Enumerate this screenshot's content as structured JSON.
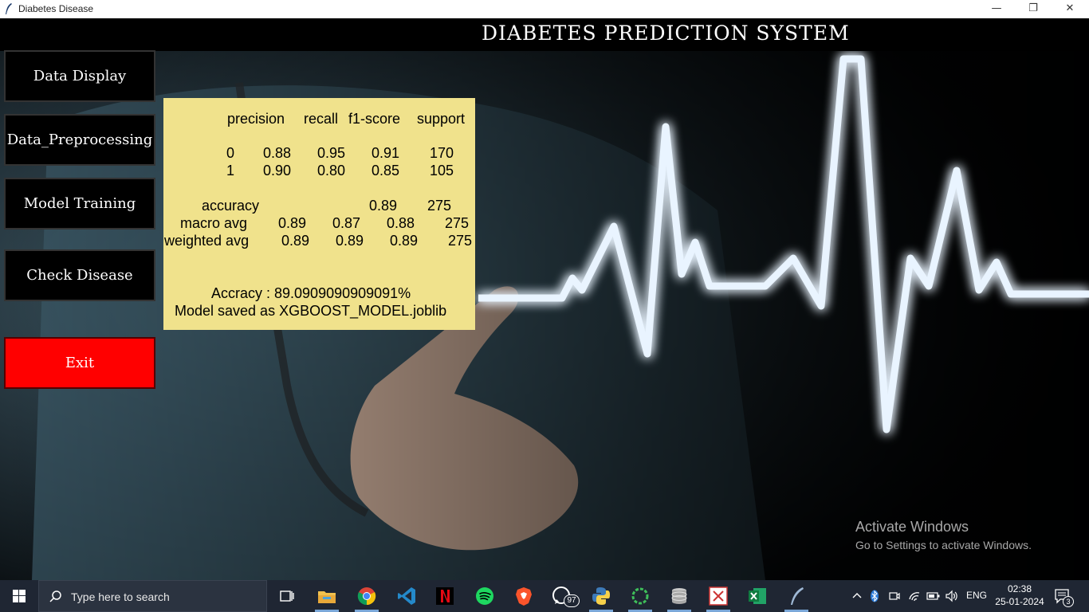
{
  "window": {
    "title": "Diabetes Disease",
    "minimize": "—",
    "maximize": "❐",
    "close": "✕"
  },
  "app": {
    "title": "DIABETES PREDICTION SYSTEM"
  },
  "sidebar": {
    "items": [
      {
        "label": "Data Display"
      },
      {
        "label": "Data_Preprocessing"
      },
      {
        "label": "Model Training"
      },
      {
        "label": "Check Disease"
      },
      {
        "label": "Exit"
      }
    ]
  },
  "report": {
    "headers": [
      "precision",
      "recall",
      "f1-score",
      "support"
    ],
    "rows": [
      {
        "label": "0",
        "precision": "0.88",
        "recall": "0.95",
        "f1": "0.91",
        "support": "170"
      },
      {
        "label": "1",
        "precision": "0.90",
        "recall": "0.80",
        "f1": "0.85",
        "support": "105"
      }
    ],
    "accuracy": {
      "label": "accuracy",
      "f1": "0.89",
      "support": "275"
    },
    "macro": {
      "label": "macro avg",
      "precision": "0.89",
      "recall": "0.87",
      "f1": "0.88",
      "support": "275"
    },
    "weighted": {
      "label": "weighted avg",
      "precision": "0.89",
      "recall": "0.89",
      "f1": "0.89",
      "support": "275"
    },
    "accuracy_line": "Accracy : 89.0909090909091%",
    "saved_line": "Model saved as XGBOOST_MODEL.joblib"
  },
  "watermark": {
    "line1": "Activate Windows",
    "line2": "Go to Settings to activate Windows."
  },
  "taskbar": {
    "search_placeholder": "Type here to search",
    "whatsapp_badge": "97",
    "language": "ENG",
    "time": "02:38",
    "date": "25-01-2024",
    "notification_count": "3",
    "icons": [
      "windows-start-icon",
      "search-icon",
      "task-view-icon",
      "file-explorer-icon",
      "chrome-icon",
      "vscode-icon",
      "netflix-icon",
      "spotify-icon",
      "brave-icon",
      "whatsapp-icon",
      "python-icon",
      "refresh-app-icon",
      "database-icon",
      "snipping-icon",
      "excel-icon",
      "feather-app-icon"
    ],
    "accent": "#7aa7d8"
  }
}
